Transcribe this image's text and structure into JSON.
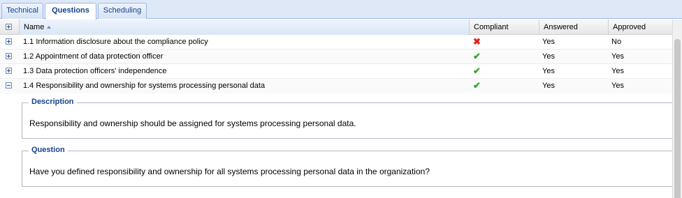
{
  "tabs": [
    {
      "label": "Technical",
      "active": false
    },
    {
      "label": "Questions",
      "active": true
    },
    {
      "label": "Scheduling",
      "active": false
    }
  ],
  "grid": {
    "columns": {
      "name": "Name",
      "compliant": "Compliant",
      "answered": "Answered",
      "approved": "Approved"
    },
    "sort": {
      "column": "Name",
      "direction": "ascending"
    },
    "rows": [
      {
        "name": "1.1 Information disclosure about the compliance policy",
        "compliant": false,
        "answered": "Yes",
        "approved": "No",
        "expanded": false
      },
      {
        "name": "1.2 Appointment of data protection officer",
        "compliant": true,
        "answered": "Yes",
        "approved": "Yes",
        "expanded": false
      },
      {
        "name": "1.3 Data protection officers' independence",
        "compliant": true,
        "answered": "Yes",
        "approved": "Yes",
        "expanded": false
      },
      {
        "name": "1.4 Responsibility and ownership for systems processing personal data",
        "compliant": true,
        "answered": "Yes",
        "approved": "Yes",
        "expanded": true
      }
    ]
  },
  "details": {
    "description": {
      "legend": "Description",
      "text": "Responsibility and ownership should be assigned for systems processing personal data."
    },
    "question": {
      "legend": "Question",
      "text": "Have you defined responsibility and ownership for all systems processing personal data in the organization?"
    }
  },
  "icons": {
    "compliant_yes": "check-icon",
    "compliant_no": "cross-icon",
    "compliant_yes_color": "#2aa52a",
    "compliant_no_color": "#e0241b"
  }
}
